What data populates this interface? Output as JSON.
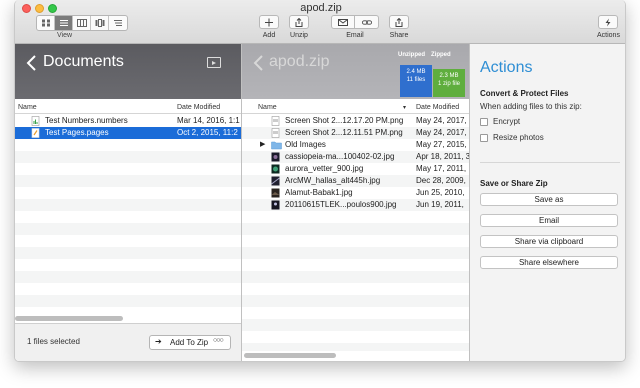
{
  "window": {
    "title": "apod.zip"
  },
  "toolbar": {
    "view_label": "View",
    "add_label": "Add",
    "unzip_label": "Unzip",
    "email_label": "Email",
    "share_label": "Share",
    "actions_label": "Actions"
  },
  "left": {
    "header_title": "Documents",
    "col_name": "Name",
    "col_date": "Date Modified",
    "files": [
      {
        "name": "Test Numbers.numbers",
        "date": "Mar 14, 2016, 1:1"
      },
      {
        "name": "Test Pages.pages",
        "date": "Oct 2, 2015, 11:2"
      }
    ],
    "status": "1 files selected",
    "add_to_zip": "Add To Zip"
  },
  "middle": {
    "header_title": "apod.zip",
    "unzipped": {
      "caption": "Unzipped",
      "size": "2.4 MB",
      "files": "11 files"
    },
    "zipped": {
      "caption": "Zipped",
      "size": "2.3 MB",
      "files": "1 zip file"
    },
    "col_name": "Name",
    "col_date": "Date Modified",
    "files": [
      {
        "name": "Screen Shot 2...12.17.20 PM.png",
        "date": "May 24, 2017,"
      },
      {
        "name": "Screen Shot 2...12.11.51 PM.png",
        "date": "May 24, 2017,"
      },
      {
        "name": "Old Images",
        "date": "May 27, 2015,"
      },
      {
        "name": "cassiopeia-ma...100402-02.jpg",
        "date": "Apr 18, 2011, 3"
      },
      {
        "name": "aurora_vetter_900.jpg",
        "date": "May 17, 2011,"
      },
      {
        "name": "ArcMW_hallas_alt445h.jpg",
        "date": "Dec 28, 2009,"
      },
      {
        "name": "Alamut-Babak1.jpg",
        "date": "Jun 25, 2010,"
      },
      {
        "name": "20110615TLEK...poulos900.jpg",
        "date": "Jun 19, 2011,"
      }
    ]
  },
  "actions": {
    "title": "Actions",
    "convert_title": "Convert & Protect Files",
    "convert_sub": "When adding files to this zip:",
    "encrypt": "Encrypt",
    "resize": "Resize photos",
    "share_title": "Save or Share Zip",
    "save_as": "Save as",
    "email": "Email",
    "share_clipboard": "Share via clipboard",
    "share_elsewhere": "Share elsewhere"
  },
  "colors": {
    "accent": "#2e8ed4",
    "selection": "#1b6cd8",
    "unzipped": "#2f6fce",
    "zipped": "#5fae3e"
  }
}
